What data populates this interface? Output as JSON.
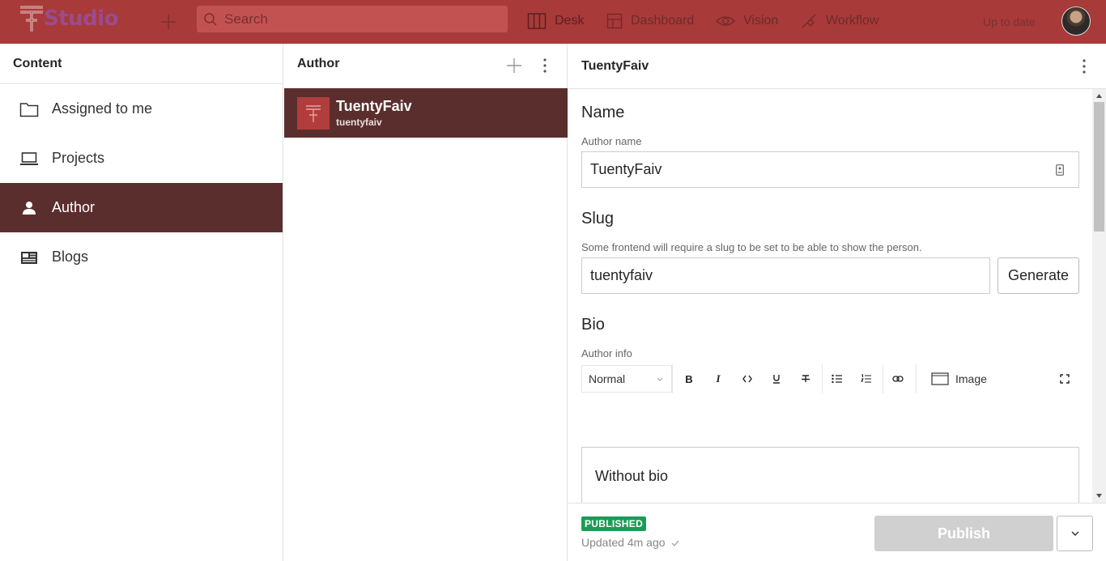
{
  "app": {
    "logo_text": "Studio",
    "status": "Up to date"
  },
  "search": {
    "placeholder": "Search"
  },
  "tools": [
    {
      "label": "Desk",
      "icon": "desk-icon"
    },
    {
      "label": "Dashboard",
      "icon": "dashboard-icon"
    },
    {
      "label": "Vision",
      "icon": "eye-icon"
    },
    {
      "label": "Workflow",
      "icon": "workflow-icon"
    }
  ],
  "content_pane": {
    "title": "Content",
    "items": [
      {
        "label": "Assigned to me",
        "icon": "folder-icon"
      },
      {
        "label": "Projects",
        "icon": "laptop-icon"
      },
      {
        "label": "Author",
        "icon": "person-icon"
      },
      {
        "label": "Blogs",
        "icon": "newspaper-icon"
      }
    ]
  },
  "author_pane": {
    "title": "Author",
    "documents": [
      {
        "title": "TuentyFaiv",
        "subtitle": "tuentyfaiv"
      }
    ]
  },
  "editor": {
    "title": "TuentyFaiv",
    "name": {
      "label": "Name",
      "description": "Author name",
      "value": "TuentyFaiv"
    },
    "slug": {
      "label": "Slug",
      "description": "Some frontend will require a slug to be set to be able to show the person.",
      "value": "tuentyfaiv",
      "generate_label": "Generate"
    },
    "bio": {
      "label": "Bio",
      "description": "Author info",
      "style_select": "Normal",
      "toolbar": {
        "bold": "B",
        "italic": "I",
        "image_label": "Image"
      },
      "content": "Without bio"
    }
  },
  "footer": {
    "badge": "PUBLISHED",
    "updated": "Updated 4m ago",
    "publish_label": "Publish"
  },
  "colors": {
    "topbar": "#a83a3a",
    "selected": "#5b2e2e",
    "published": "#1c9b57"
  }
}
